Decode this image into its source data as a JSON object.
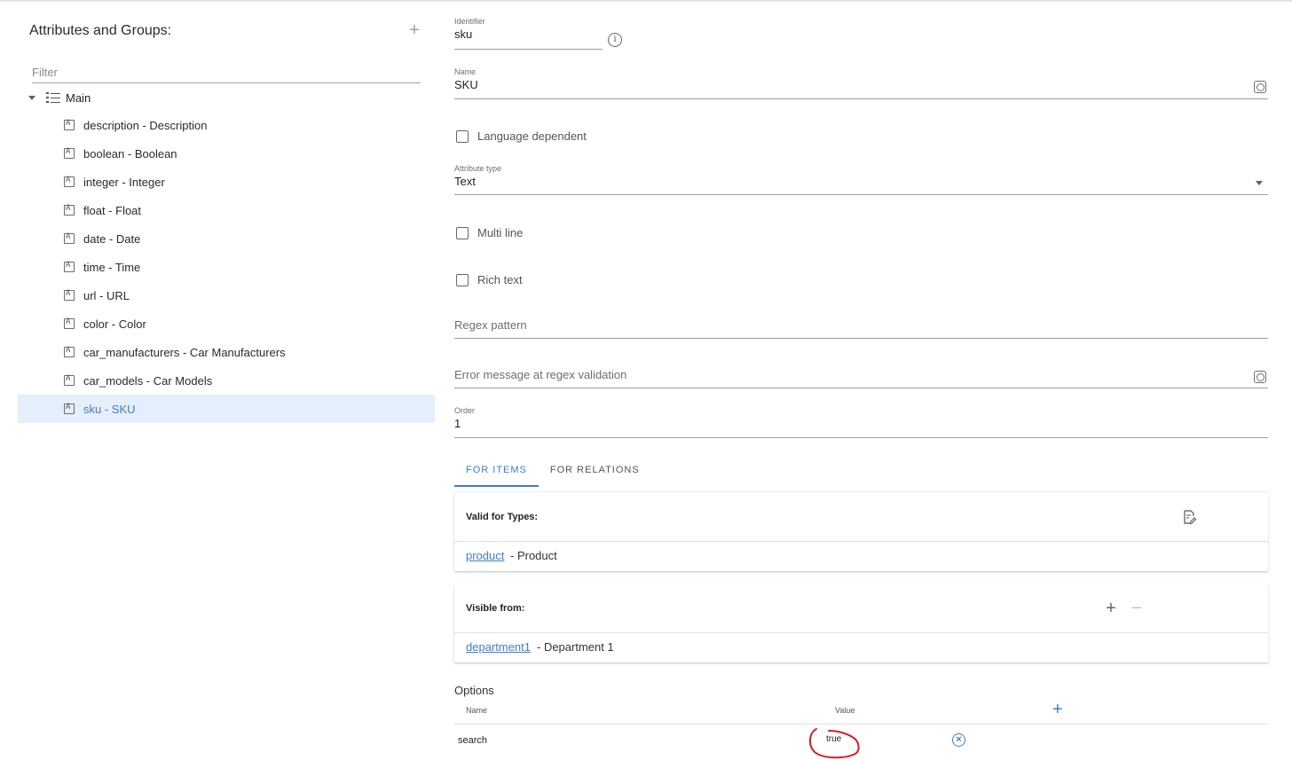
{
  "sidebar": {
    "title": "Attributes and Groups:",
    "add_icon": "plus-icon",
    "filter_placeholder": "Filter",
    "root": {
      "label": "Main",
      "icon": "list-icon"
    },
    "items": [
      {
        "label": "description - Description",
        "selected": false
      },
      {
        "label": "boolean - Boolean",
        "selected": false
      },
      {
        "label": "integer - Integer",
        "selected": false
      },
      {
        "label": "float - Float",
        "selected": false
      },
      {
        "label": "date - Date",
        "selected": false
      },
      {
        "label": "time - Time",
        "selected": false
      },
      {
        "label": "url - URL",
        "selected": false
      },
      {
        "label": "color - Color",
        "selected": false
      },
      {
        "label": "car_manufacturers - Car Manufacturers",
        "selected": false
      },
      {
        "label": "car_models - Car Models",
        "selected": false
      },
      {
        "label": "sku - SKU",
        "selected": true
      }
    ]
  },
  "form": {
    "identifier": {
      "label": "Identifier",
      "value": "sku"
    },
    "name": {
      "label": "Name",
      "value": "SKU"
    },
    "language_dependent": {
      "label": "Language dependent",
      "checked": false
    },
    "attribute_type": {
      "label": "Attribute type",
      "value": "Text"
    },
    "multi_line": {
      "label": "Multi line",
      "checked": false
    },
    "rich_text": {
      "label": "Rich text",
      "checked": false
    },
    "regex_pattern": {
      "label": "Regex pattern"
    },
    "regex_error": {
      "label": "Error message at regex validation"
    },
    "order": {
      "label": "Order",
      "value": "1"
    }
  },
  "tabs": [
    {
      "label": "FOR ITEMS",
      "active": true
    },
    {
      "label": "FOR RELATIONS",
      "active": false
    }
  ],
  "valid_types": {
    "title": "Valid for Types:",
    "link": "product",
    "text": "- Product"
  },
  "visible_from": {
    "title": "Visible from:",
    "link": "department1",
    "text": "- Department 1"
  },
  "options": {
    "title": "Options",
    "col_name": "Name",
    "col_value": "Value",
    "rows": [
      {
        "name": "search",
        "value": "true"
      }
    ]
  },
  "colors": {
    "accent": "#3f7ccf",
    "selected_bg": "#e5eefb",
    "annotation": "#e01b24"
  }
}
